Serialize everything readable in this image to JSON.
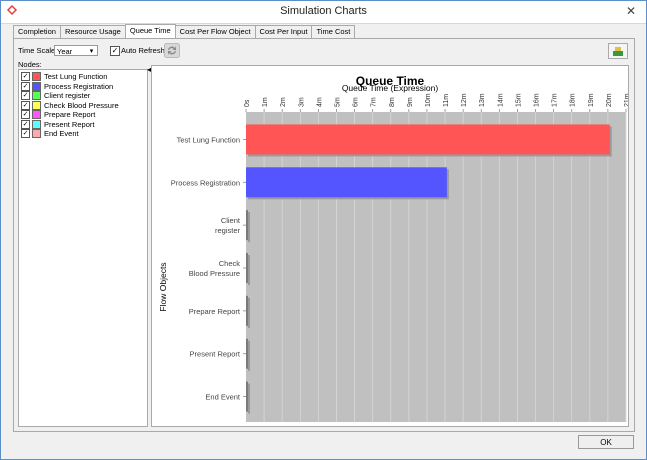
{
  "window": {
    "title": "Simulation Charts",
    "close_glyph": "✕"
  },
  "tabs": [
    {
      "label": "Completion"
    },
    {
      "label": "Resource Usage"
    },
    {
      "label": "Queue Time",
      "active": true
    },
    {
      "label": "Cost Per Flow Object"
    },
    {
      "label": "Cost Per Input"
    },
    {
      "label": "Time Cost"
    }
  ],
  "toolbar": {
    "time_scale_label": "Time Scale:",
    "time_scale_value": "Year",
    "auto_refresh_label": "Auto Refresh",
    "auto_refresh_checked": true
  },
  "nodes": {
    "label": "Nodes:",
    "items": [
      {
        "label": "Test Lung Function",
        "color": "#ff5555",
        "checked": true
      },
      {
        "label": "Process Registration",
        "color": "#5555ff",
        "checked": true
      },
      {
        "label": "Client register",
        "color": "#55ff55",
        "checked": true
      },
      {
        "label": "Check Blood Pressure",
        "color": "#ffff55",
        "checked": true
      },
      {
        "label": "Prepare Report",
        "color": "#ff55ff",
        "checked": true
      },
      {
        "label": "Present Report",
        "color": "#55ffff",
        "checked": true
      },
      {
        "label": "End Event",
        "color": "#ffaaaa",
        "checked": true
      }
    ]
  },
  "chart_data": {
    "type": "bar",
    "orientation": "horizontal",
    "title": "Queue Time",
    "xlabel": "Queue Time (Expression)",
    "ylabel": "Flow Objects",
    "x_ticks": [
      "0s",
      "1m",
      "2m",
      "3m",
      "4m",
      "5m",
      "6m",
      "7m",
      "8m",
      "9m",
      "10m",
      "11m",
      "12m",
      "13m",
      "14m",
      "15m",
      "16m",
      "17m",
      "18m",
      "19m",
      "20m",
      "21m"
    ],
    "xlim": [
      0,
      21
    ],
    "x_unit": "minutes",
    "grid": true,
    "categories": [
      "Test Lung Function",
      "Process Registration",
      "Client register",
      "Check Blood Pressure",
      "Prepare Report",
      "Present Report",
      "End Event"
    ],
    "category_display": [
      "Test Lung Function",
      "Process Registration",
      "Client\nregister",
      "Check\nBlood Pressure",
      "Prepare Report",
      "Present Report",
      "End Event"
    ],
    "values": [
      20.1,
      11.1,
      0.05,
      0.05,
      0.05,
      0.05,
      0.05
    ],
    "bar_colors": [
      "#ff5555",
      "#5555ff",
      "#7a7a7a",
      "#7a7a7a",
      "#7a7a7a",
      "#7a7a7a",
      "#7a7a7a"
    ]
  },
  "footer": {
    "ok_label": "OK"
  }
}
